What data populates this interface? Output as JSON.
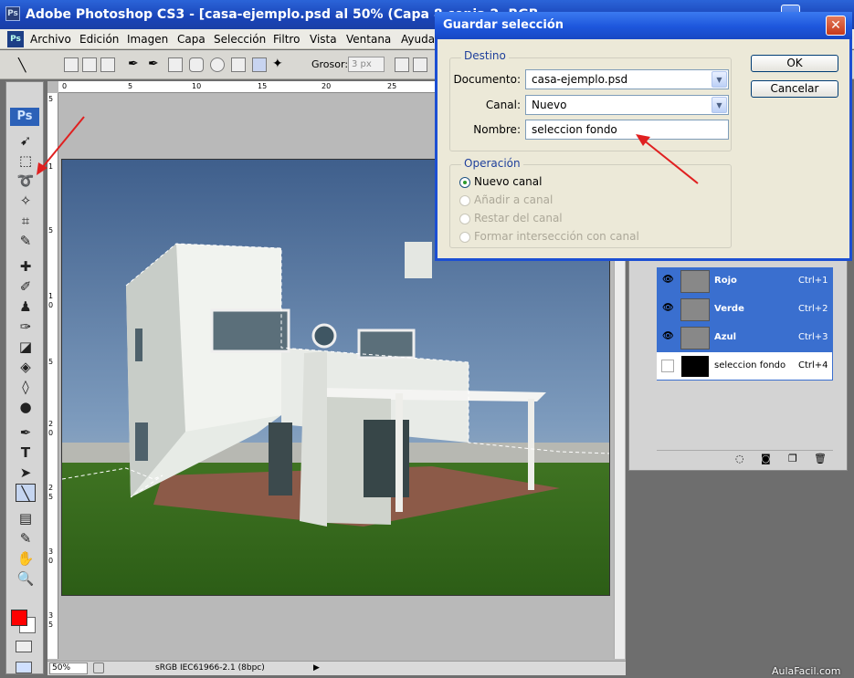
{
  "app": {
    "title": "Adobe Photoshop CS3 - [casa-ejemplo.psd al 50% (Capa 8 copia 2, RGB",
    "logo": "Ps",
    "menu": [
      "Archivo",
      "Edición",
      "Imagen",
      "Capa",
      "Selección",
      "Filtro",
      "Vista",
      "Ventana",
      "Ayuda"
    ]
  },
  "options_bar": {
    "grosor_label": "Grosor:",
    "grosor_value": "3 px"
  },
  "ruler": {
    "h_ticks": [
      "0",
      "5",
      "10",
      "15",
      "20",
      "25"
    ],
    "v_ticks": [
      "5",
      "1",
      "5",
      "1",
      "0",
      "5",
      "2",
      "0",
      "2",
      "5",
      "3",
      "0",
      "3",
      "5"
    ]
  },
  "status": {
    "zoom": "50%",
    "profile": "sRGB IEC61966-2.1 (8bpc)"
  },
  "channels": [
    {
      "name": "Rojo",
      "shortcut": "Ctrl+1",
      "selected": true
    },
    {
      "name": "Verde",
      "shortcut": "Ctrl+2",
      "selected": true
    },
    {
      "name": "Azul",
      "shortcut": "Ctrl+3",
      "selected": true
    },
    {
      "name": "seleccion fondo",
      "shortcut": "Ctrl+4",
      "selected": false
    }
  ],
  "dialog": {
    "title": "Guardar selección",
    "destino": {
      "label": "Destino",
      "documento_label": "Documento:",
      "documento_value": "casa-ejemplo.psd",
      "canal_label": "Canal:",
      "canal_value": "Nuevo",
      "nombre_label": "Nombre:",
      "nombre_value": "seleccion fondo"
    },
    "operacion": {
      "label": "Operación",
      "options": [
        "Nuevo canal",
        "Añadir a canal",
        "Restar del canal",
        "Formar intersección con canal"
      ],
      "selected_index": 0
    },
    "ok_label": "OK",
    "cancel_label": "Cancelar"
  },
  "watermark": "AulaFacil.com",
  "colors": {
    "foreground": "#ff0000",
    "background": "#ffffff",
    "arrow": "#e02020",
    "channel_selected": "#3a6fcf"
  }
}
